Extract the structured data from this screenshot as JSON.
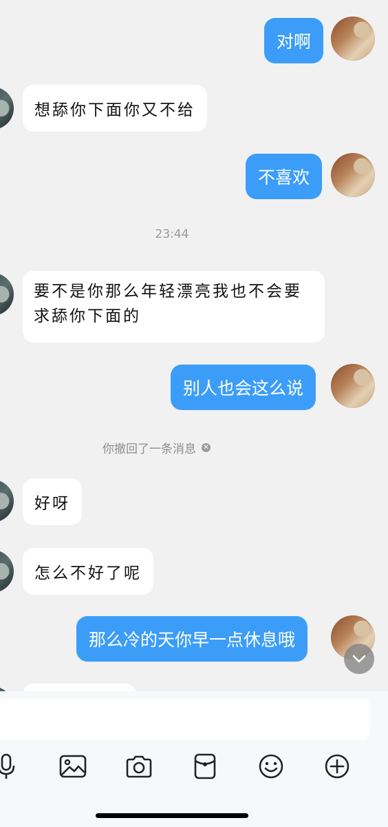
{
  "messages": [
    {
      "dir": "out",
      "text": "对啊"
    },
    {
      "dir": "in",
      "text": "想舔你下面你又不给"
    },
    {
      "dir": "out",
      "text": "不喜欢"
    },
    {
      "dir": "in",
      "line1": "要不是你那么年轻漂亮我也不会要",
      "line2": "求舔你下面的"
    },
    {
      "dir": "out",
      "text": "别人也会这么说"
    },
    {
      "dir": "in",
      "text": "好呀"
    },
    {
      "dir": "in",
      "text": "怎么不好了呢"
    },
    {
      "dir": "out",
      "text": "那么冷的天你早一点休息哦"
    }
  ],
  "timestamp": "23:44",
  "recall_notice": "你撤回了一条消息",
  "toolbar_icons": [
    "microphone-icon",
    "image-icon",
    "camera-icon",
    "red-packet-icon",
    "emoji-icon",
    "plus-icon"
  ],
  "colors": {
    "outgoing_bubble": "#3c9df8",
    "incoming_bubble": "#ffffff",
    "background": "#f1f1f1"
  }
}
